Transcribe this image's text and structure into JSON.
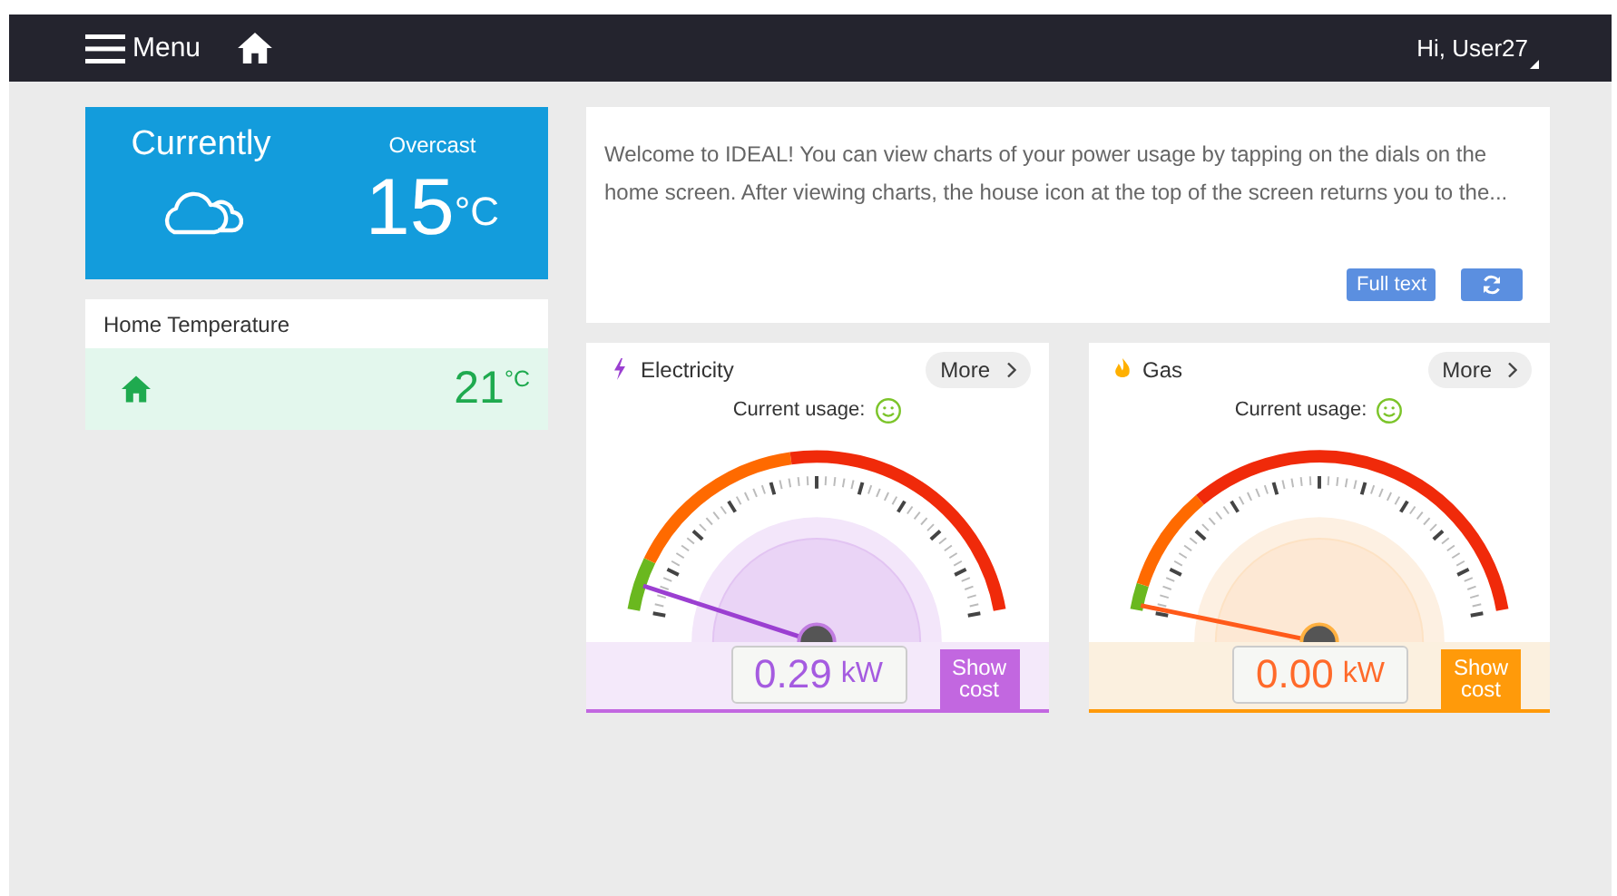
{
  "top_bar": {
    "menu_label": "Menu",
    "greeting": "Hi, User27"
  },
  "weather": {
    "title": "Currently",
    "condition": "Overcast",
    "temperature": "15",
    "unit": "°C"
  },
  "home_temperature": {
    "title": "Home Temperature",
    "temperature": "21",
    "unit": "°C"
  },
  "message": {
    "text": "Welcome to IDEAL! You can view charts of your power usage by tapping on the dials on the home screen. After viewing charts, the house icon at the top of the screen returns you to the...",
    "button": "Full text"
  },
  "meters": [
    {
      "kind": "electricity",
      "title": "Electricity",
      "more": "More",
      "usage_label": "Current usage:",
      "value": "0.29",
      "unit": "kW",
      "button": "Show cost"
    },
    {
      "kind": "gas",
      "title": "Gas",
      "more": "More",
      "usage_label": "Current usage:",
      "value": "0.00",
      "unit": "kW",
      "button": "Show cost"
    }
  ]
}
